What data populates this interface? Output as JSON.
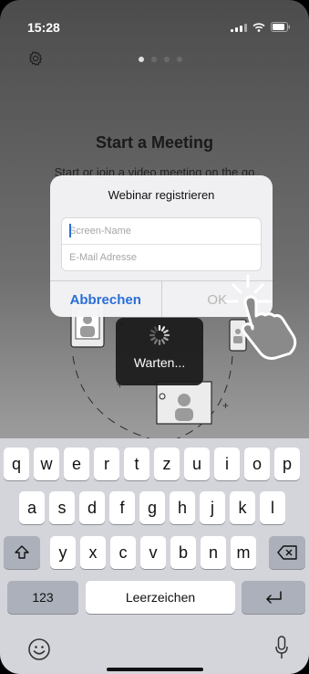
{
  "status_bar": {
    "time": "15:28"
  },
  "pager": {
    "count": 4,
    "active": 0
  },
  "main": {
    "title": "Start a Meeting",
    "subtitle": "Start or join a video meeting on the go"
  },
  "dialog": {
    "title": "Webinar registrieren",
    "screen_name": {
      "placeholder": "Screen-Name",
      "value": ""
    },
    "email": {
      "placeholder": "E-Mail Adresse",
      "value": ""
    },
    "cancel_label": "Abbrechen",
    "ok_label": "OK"
  },
  "loading": {
    "text": "Warten..."
  },
  "keyboard": {
    "row1": [
      "q",
      "w",
      "e",
      "r",
      "t",
      "z",
      "u",
      "i",
      "o",
      "p"
    ],
    "row2": [
      "a",
      "s",
      "d",
      "f",
      "g",
      "h",
      "j",
      "k",
      "l"
    ],
    "row3": [
      "y",
      "x",
      "c",
      "v",
      "b",
      "n",
      "m"
    ],
    "numbers_label": "123",
    "space_label": "Leerzeichen"
  },
  "colors": {
    "accent": "#2a6fd8",
    "keyboard_bg": "#d3d5da",
    "key_bg": "#ffffff",
    "func_key_bg": "#abb0ba"
  },
  "icons": {
    "settings": "gear-icon",
    "shift": "shift-icon",
    "backspace": "backspace-icon",
    "return": "return-icon",
    "emoji": "emoji-icon",
    "dictation": "microphone-icon",
    "tap_hint": "tap-hand-icon",
    "loading": "spinner-icon"
  }
}
